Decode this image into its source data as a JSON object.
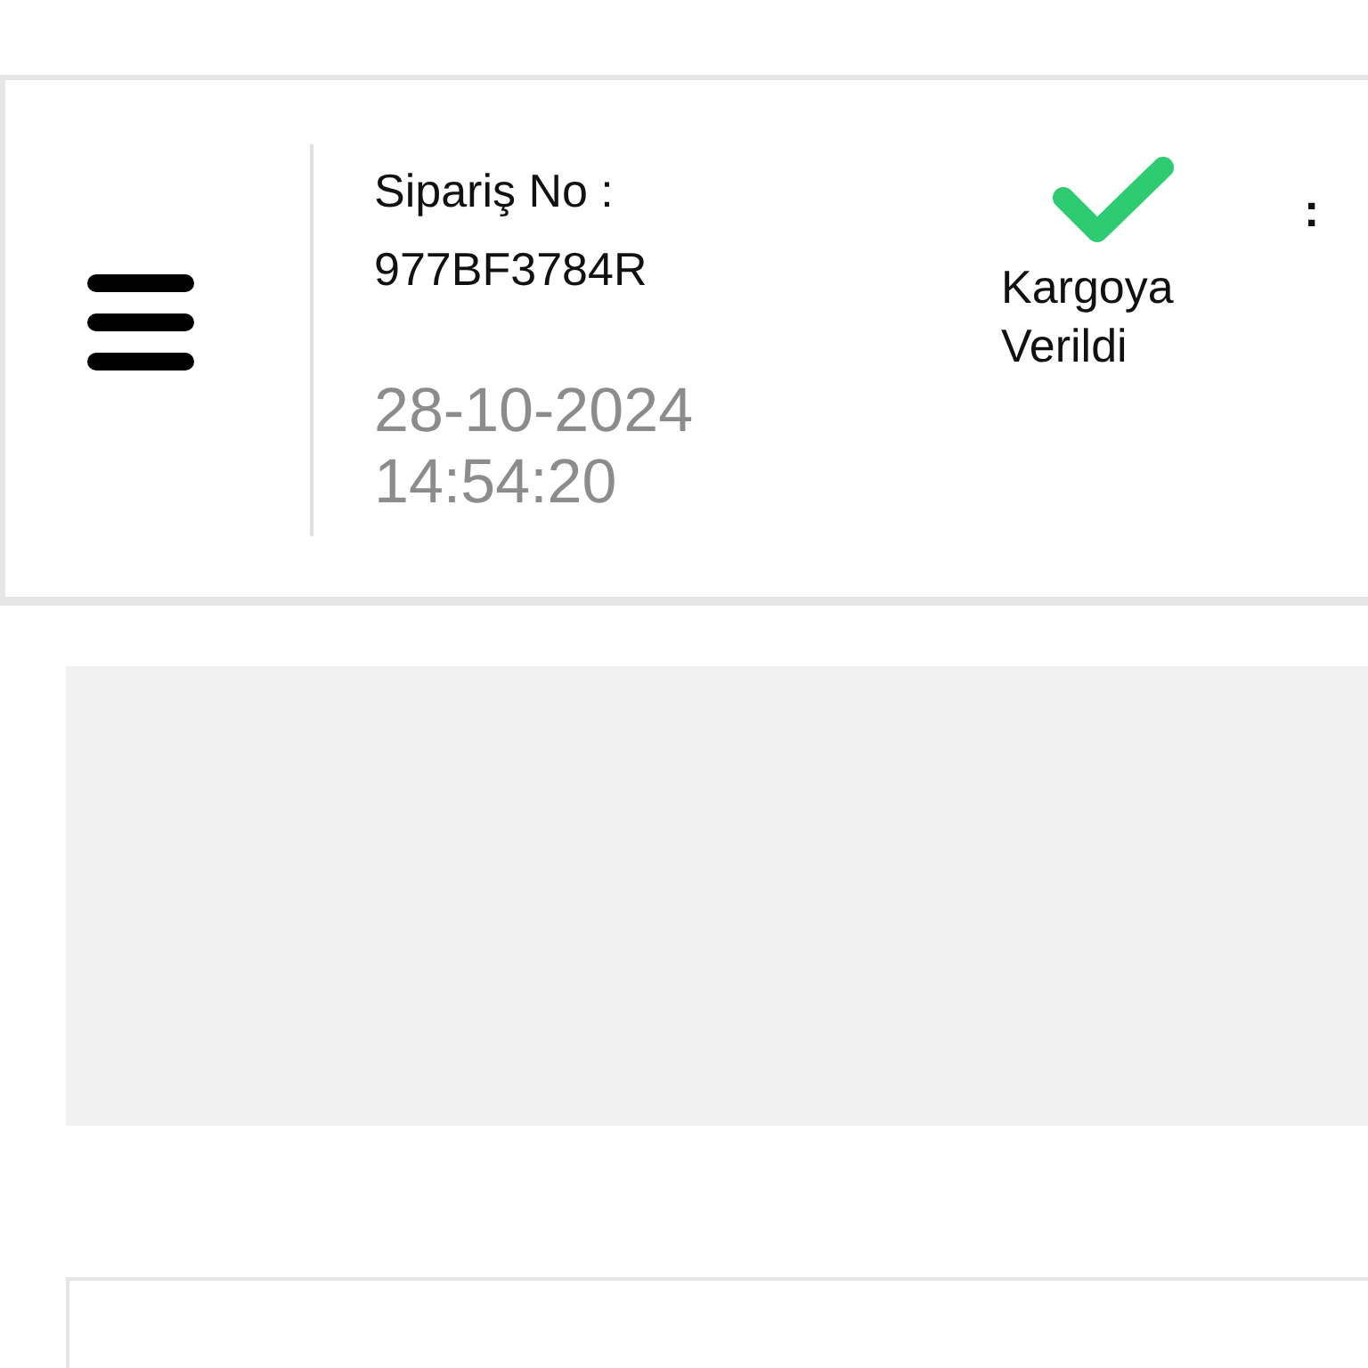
{
  "order": {
    "label": "Sipariş No :",
    "number": "977BF3784R",
    "date": "28-10-2024",
    "time": "14:54:20"
  },
  "status": {
    "kind": "check",
    "label": "Kargoya Verildi"
  },
  "column_4": ":"
}
